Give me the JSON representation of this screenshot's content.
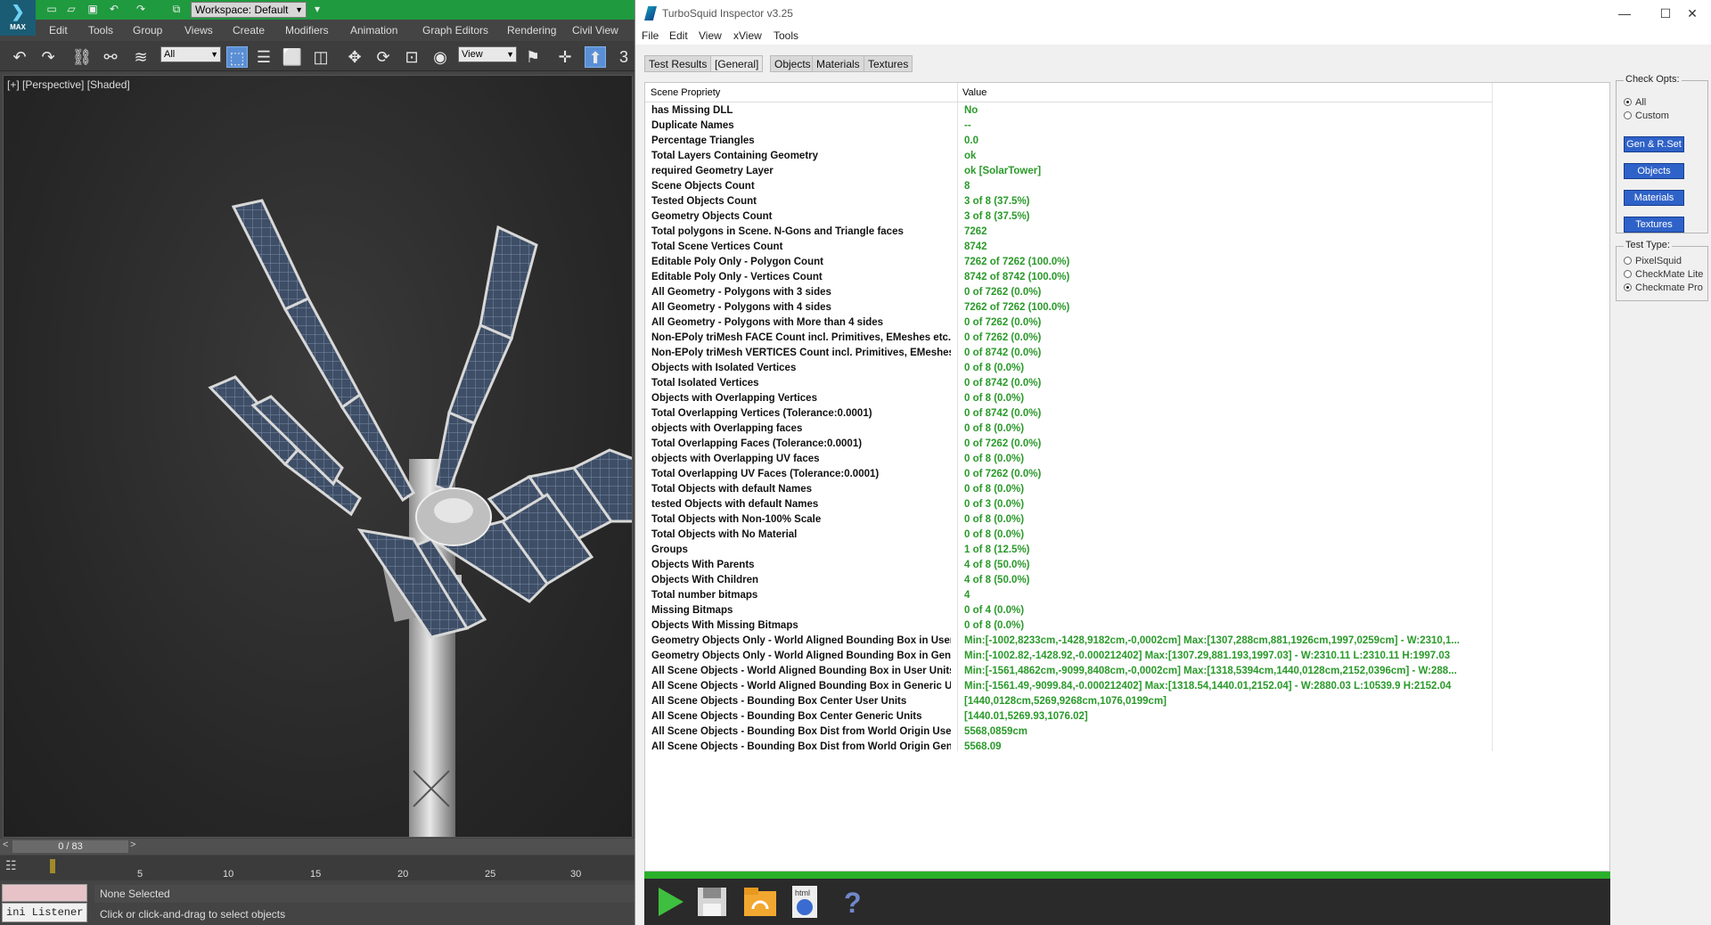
{
  "max": {
    "logo_label": "MAX",
    "workspace": "Workspace: Default",
    "menu": [
      "Edit",
      "Tools",
      "Group",
      "Views",
      "Create",
      "Modifiers",
      "Animation",
      "Graph Editors",
      "Rendering",
      "Civil View"
    ],
    "selection_filter": "All",
    "ref_coord": "View",
    "viewport_label": "[+] [Perspective] [Shaded]",
    "frame_counter": "0 / 83",
    "track_ticks": [
      "5",
      "10",
      "15",
      "20",
      "25",
      "30"
    ],
    "mini_listener": "ini Listener",
    "status_selection": "None Selected",
    "status_prompt": "Click or click-and-drag to select objects"
  },
  "ts": {
    "title": "TurboSquid Inspector v3.25",
    "menu": [
      "File",
      "Edit",
      "View",
      "xView",
      "Tools"
    ],
    "tabs": [
      "Test Results",
      "[General]",
      "Objects",
      "Materials",
      "Textures"
    ],
    "header_property": "Scene Propriety",
    "header_value": "Value",
    "rows": [
      {
        "k": "has Missing DLL",
        "v": "No"
      },
      {
        "k": "Duplicate Names",
        "v": "--"
      },
      {
        "k": "Percentage Triangles",
        "v": "0.0"
      },
      {
        "k": "Total Layers Containing Geometry",
        "v": "ok"
      },
      {
        "k": "required Geometry Layer",
        "v": "ok [SolarTower]"
      },
      {
        "k": "Scene Objects Count",
        "v": "8"
      },
      {
        "k": "Tested Objects Count",
        "v": "3 of 8 (37.5%)"
      },
      {
        "k": "Geometry Objects Count",
        "v": "3 of 8 (37.5%)"
      },
      {
        "k": "Total polygons in Scene. N-Gons and Triangle faces",
        "v": "7262"
      },
      {
        "k": "Total Scene Vertices Count",
        "v": "8742"
      },
      {
        "k": "Editable Poly Only - Polygon Count",
        "v": "7262 of 7262 (100.0%)"
      },
      {
        "k": "Editable Poly Only - Vertices Count",
        "v": "8742 of 8742 (100.0%)"
      },
      {
        "k": "All Geometry - Polygons with 3 sides",
        "v": "0 of 7262 (0.0%)"
      },
      {
        "k": "All Geometry - Polygons with 4 sides",
        "v": "7262 of 7262 (100.0%)"
      },
      {
        "k": "All Geometry - Polygons with More than 4 sides",
        "v": "0 of 7262 (0.0%)"
      },
      {
        "k": "Non-EPoly triMesh FACE Count incl. Primitives, EMeshes etc...",
        "v": "0 of 7262 (0.0%)"
      },
      {
        "k": "Non-EPoly triMesh VERTICES Count incl. Primitives, EMeshes ...",
        "v": "0 of 8742 (0.0%)"
      },
      {
        "k": "Objects with Isolated Vertices",
        "v": "0 of 8 (0.0%)"
      },
      {
        "k": "Total Isolated Vertices",
        "v": "0 of 8742 (0.0%)"
      },
      {
        "k": "Objects with Overlapping Vertices",
        "v": "0 of 8 (0.0%)"
      },
      {
        "k": "Total Overlapping Vertices (Tolerance:0.0001)",
        "v": "0 of 8742 (0.0%)"
      },
      {
        "k": "objects with Overlapping faces",
        "v": "0 of 8 (0.0%)"
      },
      {
        "k": "Total Overlapping Faces (Tolerance:0.0001)",
        "v": "0 of 7262 (0.0%)"
      },
      {
        "k": "objects with Overlapping UV faces",
        "v": "0 of 8 (0.0%)"
      },
      {
        "k": "Total Overlapping UV Faces (Tolerance:0.0001)",
        "v": "0 of 7262 (0.0%)"
      },
      {
        "k": "Total Objects with default Names",
        "v": "0 of 8 (0.0%)"
      },
      {
        "k": "tested Objects with default Names",
        "v": "0 of 3 (0.0%)"
      },
      {
        "k": "Total Objects with Non-100% Scale",
        "v": "0 of 8 (0.0%)"
      },
      {
        "k": "Total Objects with No Material",
        "v": "0 of 8 (0.0%)"
      },
      {
        "k": "Groups",
        "v": "1 of 8 (12.5%)"
      },
      {
        "k": "Objects With Parents",
        "v": "4 of 8 (50.0%)"
      },
      {
        "k": "Objects With Children",
        "v": "4 of 8 (50.0%)"
      },
      {
        "k": "Total number bitmaps",
        "v": "4"
      },
      {
        "k": "Missing Bitmaps",
        "v": "0 of 4 (0.0%)"
      },
      {
        "k": "Objects With Missing Bitmaps",
        "v": "0 of 8 (0.0%)"
      },
      {
        "k": "Geometry Objects Only - World Aligned Bounding Box in User...",
        "v": "Min:[-1002,8233cm,-1428,9182cm,-0,0002cm]  Max:[1307,288cm,881,1926cm,1997,0259cm] - W:2310,1..."
      },
      {
        "k": "Geometry Objects Only - World Aligned Bounding Box in Gen...",
        "v": "Min:[-1002.82,-1428.92,-0.000212402]  Max:[1307.29,881.193,1997.03] - W:2310.11 L:2310.11 H:1997.03"
      },
      {
        "k": "All Scene Objects - World Aligned Bounding Box in User Units",
        "v": "Min:[-1561,4862cm,-9099,8408cm,-0,0002cm]  Max:[1318,5394cm,1440,0128cm,2152,0396cm] - W:288..."
      },
      {
        "k": "All Scene Objects - World Aligned Bounding Box in Generic Un...",
        "v": "Min:[-1561.49,-9099.84,-0.000212402]  Max:[1318.54,1440.01,2152.04] - W:2880.03 L:10539.9 H:2152.04"
      },
      {
        "k": "All Scene Objects - Bounding Box Center User Units",
        "v": "[1440,0128cm,5269,9268cm,1076,0199cm]"
      },
      {
        "k": "All Scene Objects - Bounding Box Center Generic Units",
        "v": "[1440.01,5269.93,1076.02]"
      },
      {
        "k": "All Scene Objects - Bounding Box Dist from World Origin User...",
        "v": "5568,0859cm"
      },
      {
        "k": "All Scene Objects - Bounding Box Dist from World Origin Gen...",
        "v": "5568.09"
      }
    ],
    "check_opts": {
      "title": "Check Opts:",
      "radios": [
        "All",
        "Custom"
      ],
      "buttons": [
        "Gen & R.Set",
        "Objects",
        "Materials",
        "Textures"
      ]
    },
    "test_type": {
      "title": "Test Type:",
      "radios": [
        "PixelSquid",
        "CheckMate Lite",
        "Checkmate Pro"
      ]
    },
    "bottom_icons": [
      "play-icon",
      "save-icon",
      "folder-icon",
      "html-report-icon",
      "help-icon"
    ],
    "colors": {
      "value_green": "#2a9a2a",
      "progress_green": "#2ab02a",
      "button_blue": "#2f62c8"
    }
  }
}
